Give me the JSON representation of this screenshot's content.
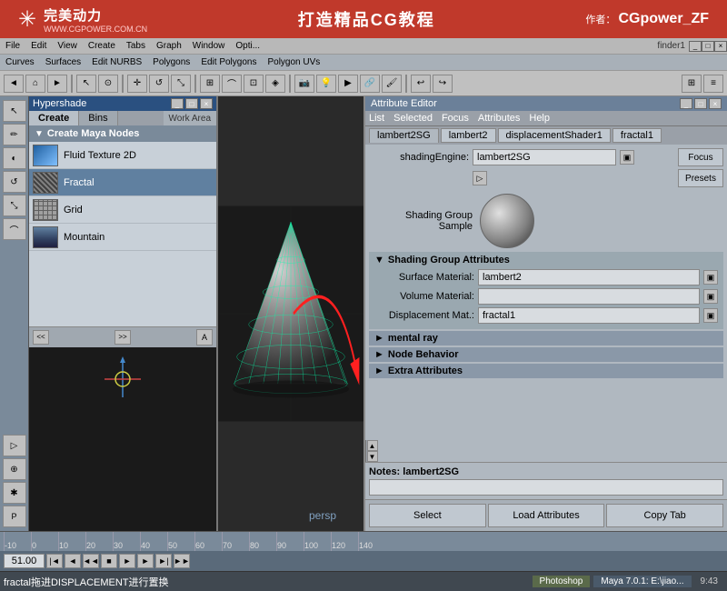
{
  "banner": {
    "logo_symbol": "✳",
    "company_name": "完美动力",
    "website": "WWW.CGPOWER.COM.CN",
    "title": "打造精品CG教程",
    "author_label": "作者：",
    "author_name": "CGpower_ZF"
  },
  "maya_menus": {
    "hypershade_title": "Hypershade",
    "menus": [
      "File",
      "Edit",
      "View",
      "Create",
      "Tabs",
      "Graph",
      "Window",
      "Opti..."
    ],
    "second_menus": [
      "Curves",
      "Surfaces",
      "Edit NURBS",
      "Polygons",
      "Edit Polygons",
      "Polygon UVs"
    ]
  },
  "hypershade": {
    "title": "Hypershade",
    "tabs": [
      "Create",
      "Bins"
    ],
    "work_area": "Work Area",
    "create_maya_nodes": "Create Maya Nodes",
    "nodes": [
      {
        "name": "Fluid Texture 2D",
        "thumb_type": "fluid"
      },
      {
        "name": "Fractal",
        "thumb_type": "fractal"
      },
      {
        "name": "Grid",
        "thumb_type": "grid"
      },
      {
        "name": "Mountain",
        "thumb_type": "mountain"
      }
    ],
    "scroll_left": "<<",
    "scroll_right": ">>"
  },
  "attribute_editor": {
    "title": "Attribute Editor",
    "menu_items": [
      "List",
      "Selected",
      "Focus",
      "Attributes",
      "Help"
    ],
    "shader_tabs": [
      "lambert2SG",
      "lambert2",
      "displacementShader1",
      "fractal1"
    ],
    "active_tab": "lambert2SG",
    "shading_engine_label": "shadingEngine:",
    "shading_engine_value": "lambert2SG",
    "shading_group_sample_label": "Shading Group Sample",
    "sections": {
      "shading_group_attrs": "Shading Group Attributes",
      "surface_material_label": "Surface Material:",
      "surface_material_value": "lambert2",
      "volume_material_label": "Volume Material:",
      "volume_material_value": "",
      "displacement_mat_label": "Displacement Mat.:",
      "displacement_mat_value": "fractal1",
      "mental_ray": "mental ray",
      "node_behavior": "Node Behavior",
      "extra_attributes": "Extra Attributes"
    },
    "notes_label": "Notes: lambert2SG",
    "notes_value": "",
    "buttons": {
      "select": "Select",
      "load_attributes": "Load Attributes",
      "copy_tab": "Copy Tab"
    }
  },
  "timeline": {
    "ticks": [
      "-10",
      "0",
      "10",
      "20",
      "30",
      "40",
      "50",
      "60",
      "70",
      "80",
      "90",
      "100"
    ],
    "extra_ticks": [
      "120",
      "140"
    ],
    "frame_value": "51.00",
    "playback_btns": [
      "|<",
      "<",
      ">",
      ">|",
      ">>"
    ]
  },
  "status_bar": {
    "photoshop_label": "Photoshop",
    "maya_label": "Maya 7.0.1: E:\\jiao...",
    "time": "9:43"
  },
  "annotation": {
    "text": "fractal拖进DISPLACEMENT进行置换"
  },
  "left_toolbar": {
    "buttons": [
      "Q",
      "W",
      "E",
      "R",
      "T",
      "↑",
      "↓",
      "⟨",
      "⟩",
      "✦",
      "⊕",
      "✱"
    ]
  }
}
